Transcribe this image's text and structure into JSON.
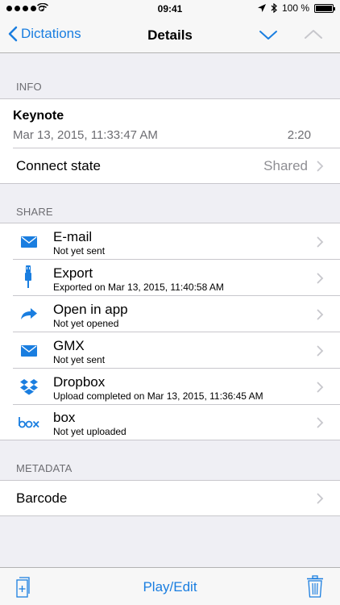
{
  "status_bar": {
    "time": "09:41",
    "battery": "100 %",
    "battery_level": 1.0
  },
  "nav": {
    "back_label": "Dictations",
    "title": "Details"
  },
  "info": {
    "header": "INFO",
    "name": "Keynote",
    "date": "Mar 13, 2015, 11:33:47 AM",
    "duration": "2:20",
    "connect_label": "Connect state",
    "connect_value": "Shared"
  },
  "share": {
    "header": "SHARE",
    "items": [
      {
        "icon": "envelope-icon",
        "title": "E-mail",
        "subtitle": "Not yet sent"
      },
      {
        "icon": "usb-plug-icon",
        "title": "Export",
        "subtitle": "Exported on Mar 13, 2015, 11:40:58 AM"
      },
      {
        "icon": "share-arrow-icon",
        "title": "Open in app",
        "subtitle": "Not yet opened"
      },
      {
        "icon": "envelope-icon",
        "title": "GMX",
        "subtitle": "Not yet sent"
      },
      {
        "icon": "dropbox-icon",
        "title": "Dropbox",
        "subtitle": "Upload completed on Mar 13, 2015, 11:36:45 AM"
      },
      {
        "icon": "box-logo-icon",
        "title": "box",
        "subtitle": "Not yet uploaded"
      }
    ]
  },
  "metadata": {
    "header": "METADATA",
    "barcode_label": "Barcode"
  },
  "footer": {
    "play_edit": "Play/Edit"
  },
  "colors": {
    "accent": "#1a7ee0",
    "background": "#efeff4",
    "secondary_text": "#8e8e93"
  }
}
